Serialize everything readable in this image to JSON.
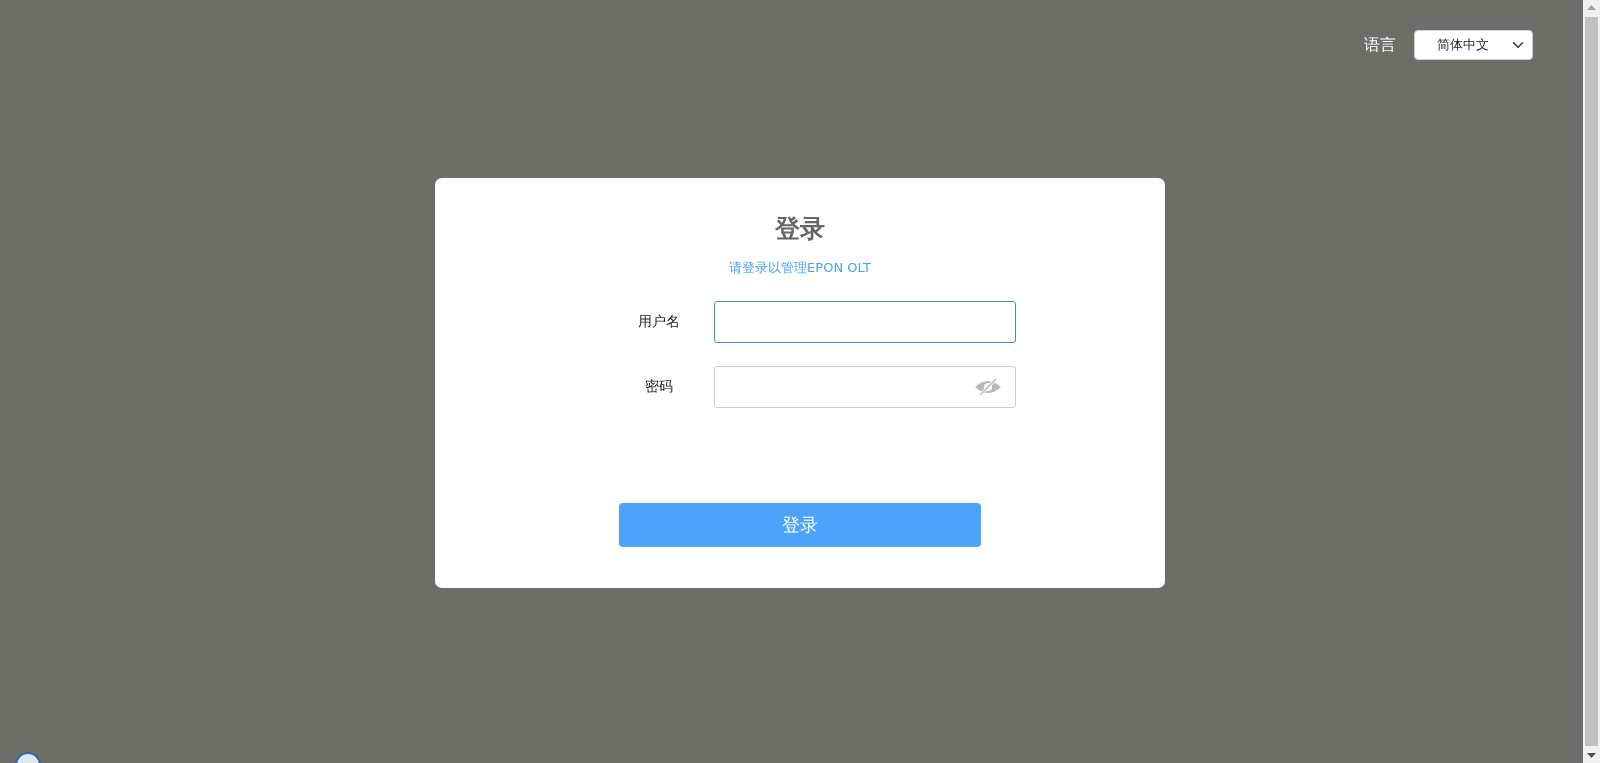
{
  "language": {
    "label": "语言",
    "value": "简体中文"
  },
  "login": {
    "title": "登录",
    "subtitle": "请登录以管理EPON OLT",
    "fields": [
      {
        "label": "用户名",
        "kind": "text",
        "focused": true
      },
      {
        "label": "密码",
        "kind": "password",
        "focused": false
      }
    ],
    "button": "登录"
  }
}
